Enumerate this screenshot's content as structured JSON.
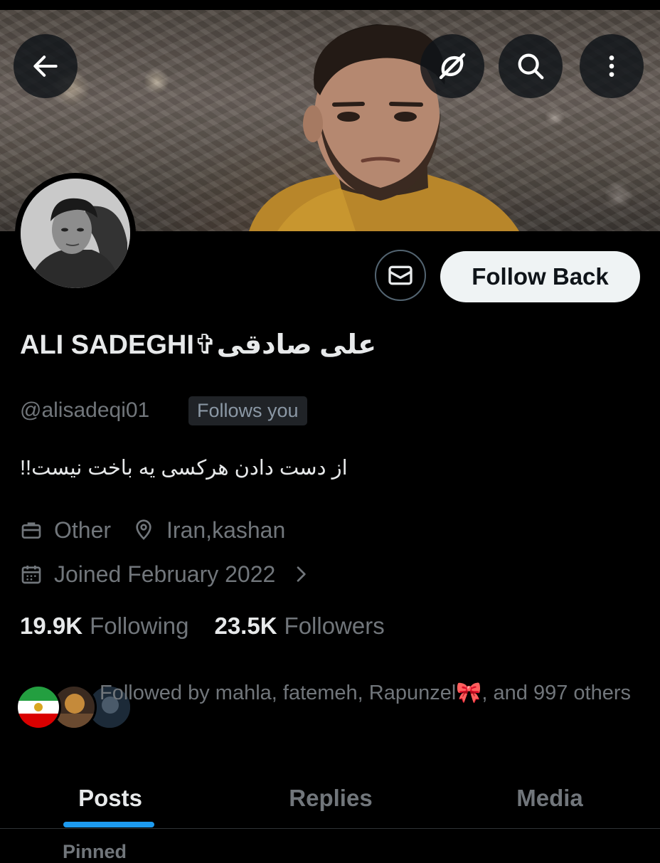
{
  "header": {
    "back_icon": "arrow-left-icon",
    "grok_icon": "grok-icon",
    "search_icon": "search-icon",
    "more_icon": "more-vertical-icon"
  },
  "profile": {
    "display_name": "ALI SADEGHI✞علی صادقی",
    "handle": "@alisadeqi01",
    "follows_you": "Follows you",
    "bio": "از دست دادن هرکسی یه باخت نیست!!",
    "category": "Other",
    "location": "Iran,kashan",
    "joined": "Joined February 2022"
  },
  "actions": {
    "message_icon": "mail-icon",
    "follow_label": "Follow Back"
  },
  "stats": {
    "following_count": "19.9K",
    "following_label": "Following",
    "followers_count": "23.5K",
    "followers_label": "Followers"
  },
  "followed_by": {
    "text": "Followed by mahla, fatemeh, Rapunzel🎀, and 997 others"
  },
  "tabs": [
    {
      "label": "Posts",
      "active": true
    },
    {
      "label": "Replies",
      "active": false
    },
    {
      "label": "Media",
      "active": false
    }
  ],
  "pinned_label": "Pinned",
  "colors": {
    "accent": "#1d9bf0",
    "background": "#000000",
    "secondary_text": "#71767b"
  }
}
